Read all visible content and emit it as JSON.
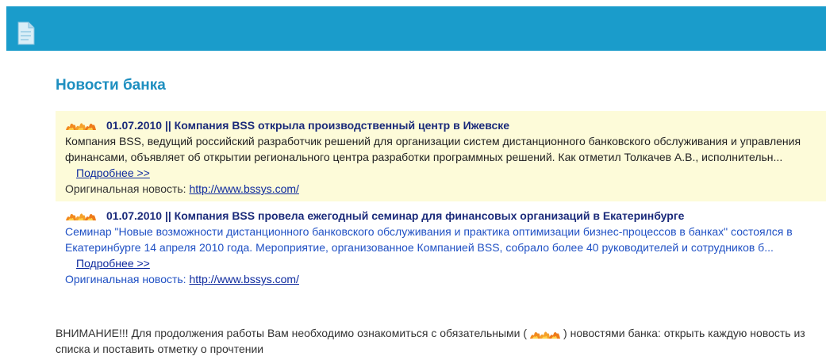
{
  "header": {
    "icon": "document-icon",
    "colors": {
      "bar": "#1a9ccb"
    }
  },
  "page": {
    "title": "Новости банка"
  },
  "news": [
    {
      "headline": "01.07.2010 || Компания BSS открыла производственный центр в Ижевске",
      "summary": "Компания BSS, ведущий российский разработчик решений для организации систем дистанционного банковского обслуживания и управления финансами, объявляет об открытии регионального центра разработки программных решений.  Как отметил Толкачев А.В., исполнительн...",
      "more_label": "Подробнее >>",
      "original_label": "Оригинальная новость:",
      "original_url": "http://www.bssys.com/",
      "highlighted": true
    },
    {
      "headline": "01.07.2010 || Компания BSS провела ежегодный семинар для финансовых организаций в Екатеринбурге",
      "summary": "Семинар \"Новые возможности дистанционного банковского обслуживания и практика оптимизации бизнес-процессов в банках\" состоялся в Екатеринбурге 14 апреля 2010 года.  Мероприятие, организованное Компанией BSS, собрало более 40 руководителей и сотрудников б...",
      "more_label": "Подробнее >>",
      "original_label": "Оригинальная новость:",
      "original_url": "http://www.bssys.com/",
      "highlighted": false
    }
  ],
  "notice": {
    "part1": "ВНИМАНИЕ!!! Для продолжения работы Вам необходимо ознакомиться с обязательными (",
    "part2": ") новостями банка: открыть каждую новость из списка и поставить отметку о прочтении",
    "icon": "flame-icon"
  }
}
